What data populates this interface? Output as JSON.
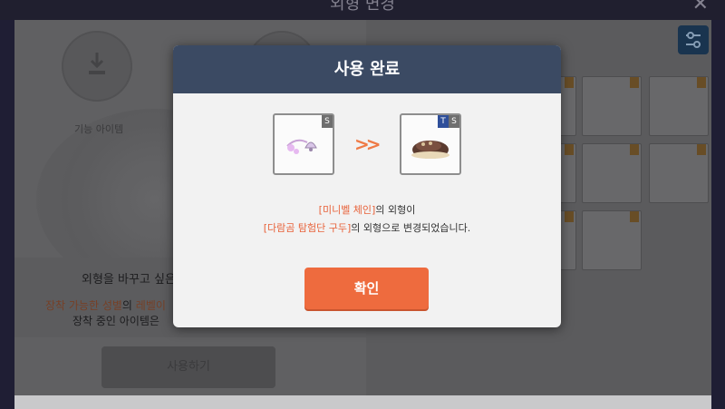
{
  "window": {
    "title": "외형 변경",
    "close_symbol": "✕"
  },
  "left_panel": {
    "slot_label": "기능 아이템",
    "info_title": "외형을 바꾸고 싶은",
    "info_line1_parts": [
      "장착 가능한 성별",
      "의 ",
      "레벨이"
    ],
    "info_line2": "장착 중인 아이템은",
    "use_button_label": "사용하기"
  },
  "modal": {
    "title": "사용 완료",
    "from_item": {
      "icon": "bell-chain-icon",
      "badge": "S"
    },
    "to_item": {
      "icon": "shoes-icon",
      "badges": [
        "T",
        "S"
      ]
    },
    "arrow_text": ">>",
    "message": {
      "line1_highlight": "[미니벨 체인]",
      "line1_rest": "의 외형이",
      "line2_highlight": "[다람곰 탐험단 구두]",
      "line2_rest": "의 외형으로 변경되었습니다."
    },
    "confirm_label": "확인"
  },
  "colors": {
    "modal_header": "#3b4a63",
    "accent_orange": "#ee6b3e",
    "highlight_text": "#e8623a"
  }
}
